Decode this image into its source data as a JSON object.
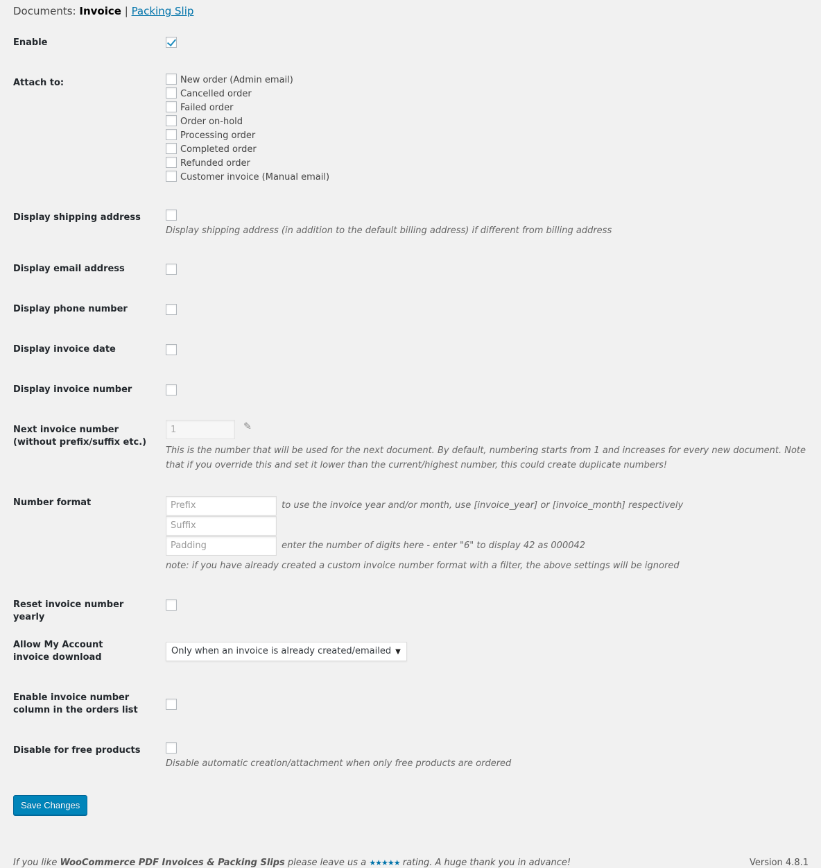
{
  "docs_nav": {
    "prefix": "Documents:",
    "current": "Invoice",
    "separator": "|",
    "other_link": "Packing Slip"
  },
  "settings": {
    "enable": {
      "label": "Enable",
      "checked": true
    },
    "attach_to": {
      "label": "Attach to:",
      "options": [
        {
          "label": "New order (Admin email)",
          "checked": false
        },
        {
          "label": "Cancelled order",
          "checked": false
        },
        {
          "label": "Failed order",
          "checked": false
        },
        {
          "label": "Order on-hold",
          "checked": false
        },
        {
          "label": "Processing order",
          "checked": false
        },
        {
          "label": "Completed order",
          "checked": false
        },
        {
          "label": "Refunded order",
          "checked": false
        },
        {
          "label": "Customer invoice (Manual email)",
          "checked": false
        }
      ]
    },
    "display_shipping_address": {
      "label": "Display shipping address",
      "checked": false,
      "description": "Display shipping address (in addition to the default billing address) if different from billing address"
    },
    "display_email_address": {
      "label": "Display email address",
      "checked": false
    },
    "display_phone_number": {
      "label": "Display phone number",
      "checked": false
    },
    "display_invoice_date": {
      "label": "Display invoice date",
      "checked": false
    },
    "display_invoice_number": {
      "label": "Display invoice number",
      "checked": false
    },
    "next_invoice_number": {
      "label": "Next invoice number (without prefix/suffix etc.)",
      "value": "1",
      "description": "This is the number that will be used for the next document. By default, numbering starts from 1 and increases for every new document. Note that if you override this and set it lower than the current/highest number, this could create duplicate numbers!"
    },
    "number_format": {
      "label": "Number format",
      "prefix_placeholder": "Prefix",
      "prefix_value": "",
      "prefix_hint": "to use the invoice year and/or month, use [invoice_year] or [invoice_month] respectively",
      "suffix_placeholder": "Suffix",
      "suffix_value": "",
      "padding_placeholder": "Padding",
      "padding_value": "",
      "padding_hint": "enter the number of digits here - enter \"6\" to display 42 as 000042",
      "note": "note: if you have already created a custom invoice number format with a filter, the above settings will be ignored"
    },
    "reset_yearly": {
      "label": "Reset invoice number yearly",
      "checked": false
    },
    "my_account_download": {
      "label": "Allow My Account invoice download",
      "selected": "Only when an invoice is already created/emailed"
    },
    "invoice_number_column": {
      "label": "Enable invoice number column in the orders list",
      "checked": false
    },
    "disable_free": {
      "label": "Disable for free products",
      "checked": false,
      "description": "Disable automatic creation/attachment when only free products are ordered"
    }
  },
  "save_button": "Save Changes",
  "footer": {
    "text_before": "If you like ",
    "plugin_name": "WooCommerce PDF Invoices & Packing Slips",
    "text_middle": " please leave us a ",
    "stars": "★★★★★",
    "text_after": " rating. A huge thank you in advance!",
    "version": "Version 4.8.1"
  }
}
